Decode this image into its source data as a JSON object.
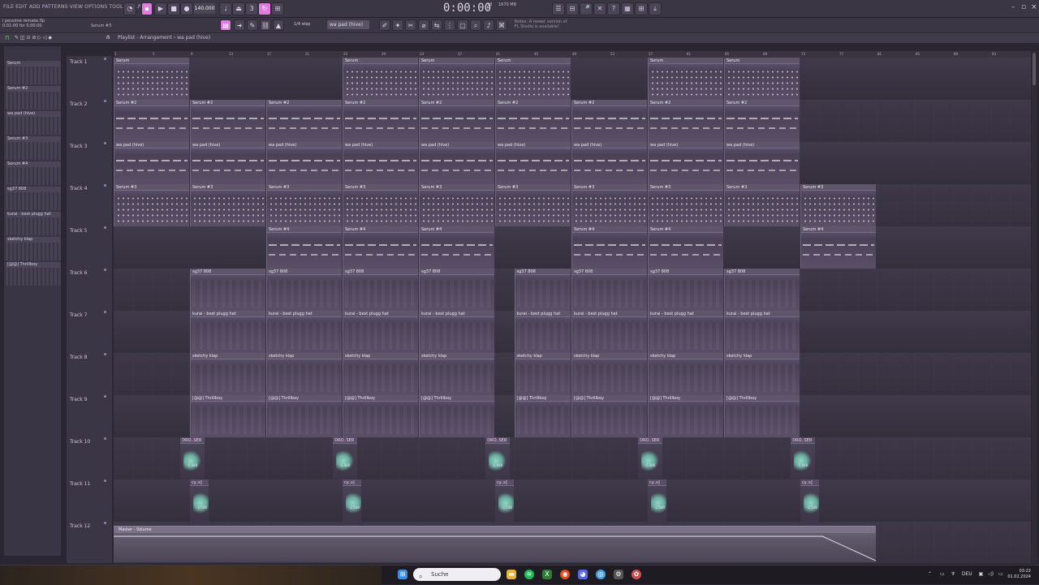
{
  "menu": [
    "FILE",
    "EDIT",
    "ADD",
    "PATTERNS",
    "VIEW",
    "OPTIONS",
    "TOOLS",
    "HELP"
  ],
  "transport": {
    "tempo": "140.000",
    "time": "0:00:00",
    "step": "1/4 step",
    "pattern": "wa pad (hive)"
  },
  "cpu": {
    "cores": "18",
    "mem": "1670 MB",
    "voices": "0"
  },
  "notice": "Notes: A newer version of FL Studio is available!",
  "project": {
    "file": "i pessime remake.flp",
    "range": "0:01:00 for 0:00:00",
    "current_pattern": "Serum #3"
  },
  "playlist": {
    "title": "Playlist - Arrangement › wa pad (hive)"
  },
  "pattern_picker": [
    {
      "name": "Serum"
    },
    {
      "name": "Serum #2"
    },
    {
      "name": "wa pad (hive)"
    },
    {
      "name": "Serum #3"
    },
    {
      "name": "Serum #4"
    },
    {
      "name": "sg37 808"
    },
    {
      "name": "kurai - best plugg hat"
    },
    {
      "name": "sketchy klap"
    },
    {
      "name": "[@@] Thrillboy"
    }
  ],
  "ruler_marks": [
    "1",
    "5",
    "9",
    "13",
    "17",
    "21",
    "25",
    "29",
    "33",
    "37",
    "41",
    "45",
    "49",
    "53",
    "57",
    "61",
    "65",
    "69",
    "73",
    "77",
    "81",
    "85",
    "89",
    "93"
  ],
  "tracks": [
    "Track 1",
    "Track 2",
    "Track 3",
    "Track 4",
    "Track 5",
    "Track 6",
    "Track 7",
    "Track 8",
    "Track 9",
    "Track 10",
    "Track 11",
    "Track 12"
  ],
  "lanes": [
    {
      "clips": [
        {
          "name": "Serum",
          "bar": 1,
          "len": 4,
          "style": "melody"
        },
        {
          "name": "Serum",
          "bar": 13,
          "len": 4,
          "style": "melody"
        },
        {
          "name": "Serum",
          "bar": 17,
          "len": 4,
          "style": "melody"
        },
        {
          "name": "Serum",
          "bar": 21,
          "len": 4,
          "style": "melody"
        },
        {
          "name": "Serum",
          "bar": 29,
          "len": 4,
          "style": "melody"
        },
        {
          "name": "Serum",
          "bar": 33,
          "len": 4,
          "style": "melody"
        }
      ]
    },
    {
      "clips": [
        {
          "name": "Serum #2",
          "bar": 1,
          "len": 4,
          "style": "long"
        },
        {
          "name": "Serum #2",
          "bar": 5,
          "len": 4,
          "style": "long"
        },
        {
          "name": "Serum #2",
          "bar": 9,
          "len": 4,
          "style": "long"
        },
        {
          "name": "Serum #2",
          "bar": 13,
          "len": 4,
          "style": "long"
        },
        {
          "name": "Serum #2",
          "bar": 17,
          "len": 4,
          "style": "long"
        },
        {
          "name": "Serum #2",
          "bar": 21,
          "len": 4,
          "style": "long"
        },
        {
          "name": "Serum #2",
          "bar": 25,
          "len": 4,
          "style": "long"
        },
        {
          "name": "Serum #2",
          "bar": 29,
          "len": 4,
          "style": "long"
        },
        {
          "name": "Serum #2",
          "bar": 33,
          "len": 4,
          "style": "long"
        }
      ]
    },
    {
      "clips": [
        {
          "name": "wa pad (hive)",
          "bar": 1,
          "len": 4,
          "style": "long"
        },
        {
          "name": "wa pad (hive)",
          "bar": 5,
          "len": 4,
          "style": "long"
        },
        {
          "name": "wa pad (hive)",
          "bar": 9,
          "len": 4,
          "style": "long"
        },
        {
          "name": "wa pad (hive)",
          "bar": 13,
          "len": 4,
          "style": "long"
        },
        {
          "name": "wa pad (hive)",
          "bar": 17,
          "len": 4,
          "style": "long"
        },
        {
          "name": "wa pad (hive)",
          "bar": 21,
          "len": 4,
          "style": "long"
        },
        {
          "name": "wa pad (hive)",
          "bar": 25,
          "len": 4,
          "style": "long"
        },
        {
          "name": "wa pad (hive)",
          "bar": 29,
          "len": 4,
          "style": "long"
        },
        {
          "name": "wa pad (hive)",
          "bar": 33,
          "len": 4,
          "style": "long"
        }
      ]
    },
    {
      "clips": [
        {
          "name": "Serum #3",
          "bar": 1,
          "len": 4,
          "style": "melody"
        },
        {
          "name": "Serum #3",
          "bar": 5,
          "len": 4,
          "style": "melody"
        },
        {
          "name": "Serum #3",
          "bar": 9,
          "len": 4,
          "style": "melody"
        },
        {
          "name": "Serum #3",
          "bar": 13,
          "len": 4,
          "style": "melody"
        },
        {
          "name": "Serum #3",
          "bar": 17,
          "len": 4,
          "style": "melody"
        },
        {
          "name": "Serum #3",
          "bar": 21,
          "len": 4,
          "style": "melody"
        },
        {
          "name": "Serum #3",
          "bar": 25,
          "len": 4,
          "style": "melody"
        },
        {
          "name": "Serum #3",
          "bar": 29,
          "len": 4,
          "style": "melody"
        },
        {
          "name": "Serum #3",
          "bar": 33,
          "len": 4,
          "style": "melody"
        },
        {
          "name": "Serum #3",
          "bar": 37,
          "len": 4,
          "style": "melody"
        }
      ]
    },
    {
      "clips": [
        {
          "name": "Serum #4",
          "bar": 9,
          "len": 4,
          "style": "long"
        },
        {
          "name": "Serum #4",
          "bar": 13,
          "len": 4,
          "style": "long"
        },
        {
          "name": "Serum #4",
          "bar": 17,
          "len": 4,
          "style": "long"
        },
        {
          "name": "Serum #4",
          "bar": 25,
          "len": 4,
          "style": "long"
        },
        {
          "name": "Serum #4",
          "bar": 29,
          "len": 4,
          "style": "long"
        },
        {
          "name": "Serum #4",
          "bar": 37,
          "len": 4,
          "style": "long"
        }
      ]
    },
    {
      "clips": [
        {
          "name": "sg37 808",
          "bar": 5,
          "len": 4,
          "style": "faint"
        },
        {
          "name": "sg37 808",
          "bar": 9,
          "len": 4,
          "style": "faint"
        },
        {
          "name": "sg37 808",
          "bar": 13,
          "len": 4,
          "style": "faint"
        },
        {
          "name": "sg37 808",
          "bar": 17,
          "len": 4,
          "style": "faint"
        },
        {
          "name": "sg37 808",
          "bar": 22,
          "len": 3,
          "style": "faint"
        },
        {
          "name": "sg37 808",
          "bar": 25,
          "len": 4,
          "style": "faint"
        },
        {
          "name": "sg37 808",
          "bar": 29,
          "len": 4,
          "style": "faint"
        },
        {
          "name": "sg37 808",
          "bar": 33,
          "len": 4,
          "style": "faint"
        }
      ]
    },
    {
      "clips": [
        {
          "name": "kurai - best plugg hat",
          "bar": 5,
          "len": 4,
          "style": "faint"
        },
        {
          "name": "kurai - best plugg hat",
          "bar": 9,
          "len": 4,
          "style": "faint"
        },
        {
          "name": "kurai - best plugg hat",
          "bar": 13,
          "len": 4,
          "style": "faint"
        },
        {
          "name": "kurai - best plugg hat",
          "bar": 17,
          "len": 4,
          "style": "faint"
        },
        {
          "name": "kurai - best plugg hat",
          "bar": 22,
          "len": 3,
          "style": "faint"
        },
        {
          "name": "kurai - best plugg hat",
          "bar": 25,
          "len": 4,
          "style": "faint"
        },
        {
          "name": "kurai - best plugg hat",
          "bar": 29,
          "len": 4,
          "style": "faint"
        },
        {
          "name": "kurai - best plugg hat",
          "bar": 33,
          "len": 4,
          "style": "faint"
        }
      ]
    },
    {
      "clips": [
        {
          "name": "sketchy klap",
          "bar": 5,
          "len": 4,
          "style": "faint"
        },
        {
          "name": "sketchy klap",
          "bar": 9,
          "len": 4,
          "style": "faint"
        },
        {
          "name": "sketchy klap",
          "bar": 13,
          "len": 4,
          "style": "faint"
        },
        {
          "name": "sketchy klap",
          "bar": 17,
          "len": 4,
          "style": "faint"
        },
        {
          "name": "sketchy klap",
          "bar": 22,
          "len": 3,
          "style": "faint"
        },
        {
          "name": "sketchy klap",
          "bar": 25,
          "len": 4,
          "style": "faint"
        },
        {
          "name": "sketchy klap",
          "bar": 29,
          "len": 4,
          "style": "faint"
        },
        {
          "name": "sketchy klap",
          "bar": 33,
          "len": 4,
          "style": "faint"
        }
      ]
    },
    {
      "clips": [
        {
          "name": "[@@] Thrillboy",
          "bar": 5,
          "len": 4,
          "style": "faint"
        },
        {
          "name": "[@@] Thrillboy",
          "bar": 9,
          "len": 4,
          "style": "faint"
        },
        {
          "name": "[@@] Thrillboy",
          "bar": 13,
          "len": 4,
          "style": "faint"
        },
        {
          "name": "[@@] Thrillboy",
          "bar": 17,
          "len": 4,
          "style": "faint"
        },
        {
          "name": "[@@] Thrillboy",
          "bar": 22,
          "len": 3,
          "style": "faint"
        },
        {
          "name": "[@@] Thrillboy",
          "bar": 25,
          "len": 4,
          "style": "faint"
        },
        {
          "name": "[@@] Thrillboy",
          "bar": 29,
          "len": 4,
          "style": "faint"
        },
        {
          "name": "[@@] Thrillboy",
          "bar": 33,
          "len": 4,
          "style": "faint"
        }
      ]
    },
    {
      "clips": [
        {
          "name": "DRO..SER",
          "bar": 4.5,
          "len": 1.3,
          "style": "audio",
          "db": "-5.0dB"
        },
        {
          "name": "DRO..SER",
          "bar": 12.5,
          "len": 1.3,
          "style": "audio",
          "db": "-5.0dB"
        },
        {
          "name": "DRO..SER",
          "bar": 20.5,
          "len": 1.3,
          "style": "audio",
          "db": "-5.0dB"
        },
        {
          "name": "DRO..SER",
          "bar": 28.5,
          "len": 1.3,
          "style": "audio",
          "db": "-5.0dB"
        },
        {
          "name": "DRO..SER",
          "bar": 36.5,
          "len": 1.3,
          "style": "audio",
          "db": "-5.0dB"
        }
      ]
    },
    {
      "clips": [
        {
          "name": "cy..s]",
          "bar": 5,
          "len": 1,
          "style": "audio",
          "db": "-2.5dB"
        },
        {
          "name": "cy..s]",
          "bar": 13,
          "len": 1,
          "style": "audio",
          "db": "-2.5dB"
        },
        {
          "name": "cy..s]",
          "bar": 21,
          "len": 1,
          "style": "audio",
          "db": "-2.5dB"
        },
        {
          "name": "cy..s]",
          "bar": 29,
          "len": 1,
          "style": "audio",
          "db": "-2.5dB"
        },
        {
          "name": "cy..s]",
          "bar": 37,
          "len": 1,
          "style": "audio",
          "db": "-2.5dB"
        }
      ]
    },
    {
      "clips": [
        {
          "name": "Master - Volume",
          "bar": 1,
          "len": 40,
          "style": "auto"
        }
      ]
    }
  ],
  "taskbar": {
    "search_placeholder": "Suche",
    "lang": "DEU",
    "time": "03:22",
    "date": "01.02.2024"
  }
}
